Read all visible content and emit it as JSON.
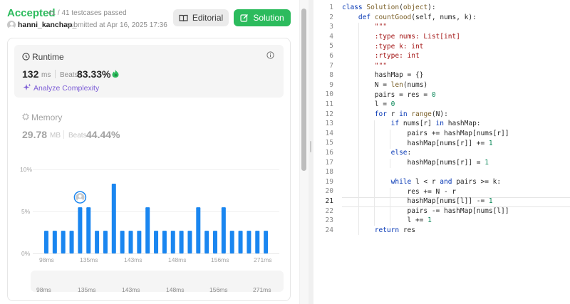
{
  "submission": {
    "status": "Accepted",
    "testcases": "41 / 41 testcases passed",
    "username": "hanni_kanchap_",
    "submitted": "submitted at Apr 16, 2025 17:36"
  },
  "buttons": {
    "editorial": "Editorial",
    "solution": "Solution"
  },
  "runtime": {
    "label": "Runtime",
    "value": "132",
    "unit": "ms",
    "beats_label": "Beats",
    "beats": "83.33%",
    "analyze": "Analyze Complexity"
  },
  "memory": {
    "label": "Memory",
    "value": "29.78",
    "unit": "MB",
    "beats_label": "Beats",
    "beats": "44.44%"
  },
  "colors": {
    "accent": "#2cbb5d",
    "bar": "#1a86f0",
    "purple": "#7c5cd6"
  },
  "icons": [
    "book-icon",
    "edit-icon",
    "clock-icon",
    "info-icon",
    "fire-icon",
    "sparkle-icon",
    "chip-icon",
    "user-avatar-icon"
  ],
  "chart_data": {
    "type": "bar",
    "y_ticks": [
      "10%",
      "5%",
      "0%"
    ],
    "ylim": [
      0,
      10
    ],
    "x_tick_labels": [
      "98ms",
      "135ms",
      "143ms",
      "148ms",
      "156ms",
      "271ms"
    ],
    "values": [
      2.7,
      2.7,
      2.7,
      2.7,
      5.5,
      5.5,
      2.7,
      2.7,
      8.3,
      2.7,
      2.7,
      2.7,
      5.5,
      2.7,
      2.7,
      2.7,
      2.7,
      2.7,
      5.5,
      2.7,
      2.7,
      5.5,
      2.7,
      2.7,
      2.7,
      2.7,
      2.7
    ],
    "highlight_index": 4,
    "mini_x_tick_labels": [
      "98ms",
      "135ms",
      "143ms",
      "148ms",
      "156ms",
      "271ms"
    ]
  },
  "code": {
    "line_numbers": [
      "1",
      "2",
      "3",
      "4",
      "5",
      "6",
      "7",
      "8",
      "9",
      "10",
      "11",
      "12",
      "13",
      "14",
      "15",
      "16",
      "17",
      "18",
      "19",
      "20",
      "21",
      "22",
      "23",
      "24"
    ],
    "active_line": "21"
  }
}
